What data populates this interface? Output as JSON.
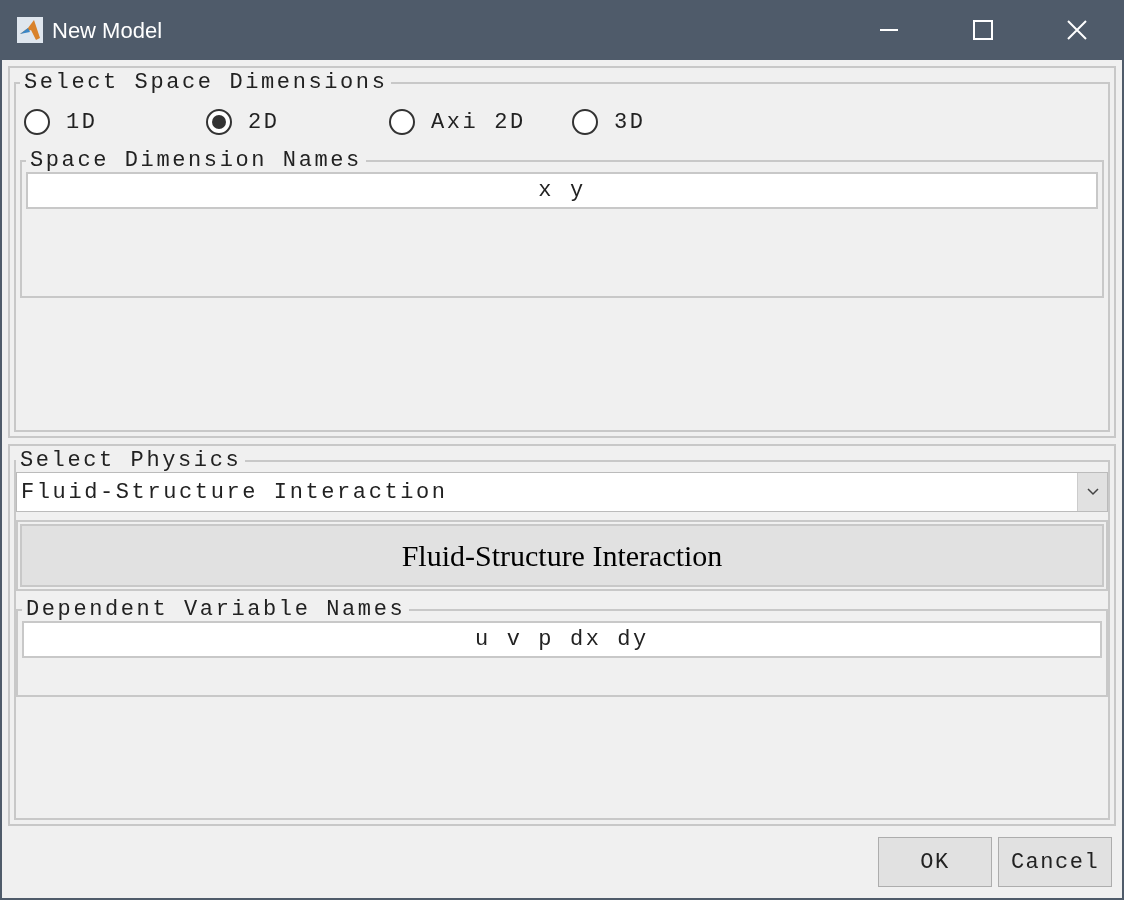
{
  "window": {
    "title": "New Model"
  },
  "space_dimensions": {
    "title": "Select Space Dimensions",
    "options": [
      {
        "label": "1D",
        "selected": false
      },
      {
        "label": "2D",
        "selected": true
      },
      {
        "label": "Axi 2D",
        "selected": false
      },
      {
        "label": "3D",
        "selected": false
      }
    ],
    "names_title": "Space Dimension Names",
    "names_value": "x y"
  },
  "physics": {
    "title": "Select Physics",
    "dropdown_value": "Fluid-Structure Interaction",
    "button_label": "Fluid-Structure Interaction",
    "variables_title": "Dependent Variable Names",
    "variables_value": "u v p dx dy"
  },
  "buttons": [
    "OK",
    "Cancel"
  ]
}
